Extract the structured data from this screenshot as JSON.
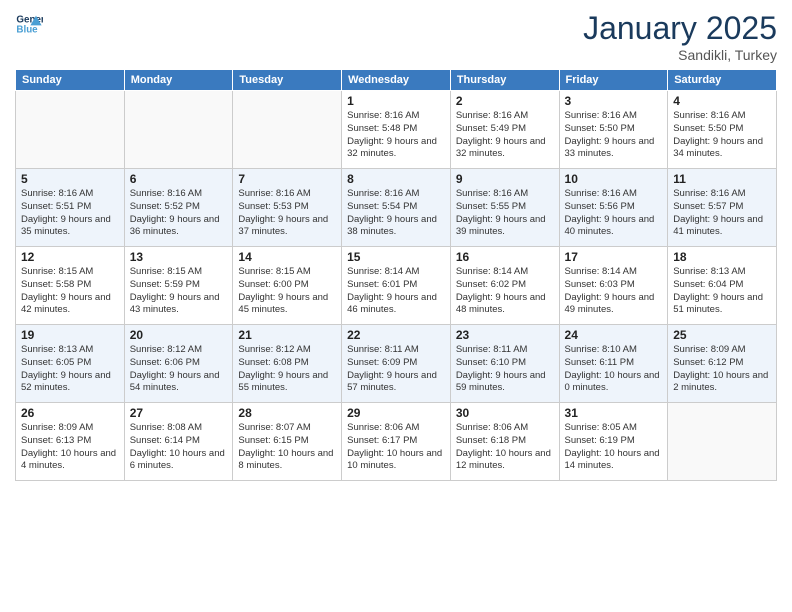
{
  "logo": {
    "line1": "General",
    "line2": "Blue"
  },
  "title": "January 2025",
  "subtitle": "Sandikli, Turkey",
  "weekdays": [
    "Sunday",
    "Monday",
    "Tuesday",
    "Wednesday",
    "Thursday",
    "Friday",
    "Saturday"
  ],
  "weeks": [
    [
      {
        "day": "",
        "info": ""
      },
      {
        "day": "",
        "info": ""
      },
      {
        "day": "",
        "info": ""
      },
      {
        "day": "1",
        "info": "Sunrise: 8:16 AM\nSunset: 5:48 PM\nDaylight: 9 hours and 32 minutes."
      },
      {
        "day": "2",
        "info": "Sunrise: 8:16 AM\nSunset: 5:49 PM\nDaylight: 9 hours and 32 minutes."
      },
      {
        "day": "3",
        "info": "Sunrise: 8:16 AM\nSunset: 5:50 PM\nDaylight: 9 hours and 33 minutes."
      },
      {
        "day": "4",
        "info": "Sunrise: 8:16 AM\nSunset: 5:50 PM\nDaylight: 9 hours and 34 minutes."
      }
    ],
    [
      {
        "day": "5",
        "info": "Sunrise: 8:16 AM\nSunset: 5:51 PM\nDaylight: 9 hours and 35 minutes."
      },
      {
        "day": "6",
        "info": "Sunrise: 8:16 AM\nSunset: 5:52 PM\nDaylight: 9 hours and 36 minutes."
      },
      {
        "day": "7",
        "info": "Sunrise: 8:16 AM\nSunset: 5:53 PM\nDaylight: 9 hours and 37 minutes."
      },
      {
        "day": "8",
        "info": "Sunrise: 8:16 AM\nSunset: 5:54 PM\nDaylight: 9 hours and 38 minutes."
      },
      {
        "day": "9",
        "info": "Sunrise: 8:16 AM\nSunset: 5:55 PM\nDaylight: 9 hours and 39 minutes."
      },
      {
        "day": "10",
        "info": "Sunrise: 8:16 AM\nSunset: 5:56 PM\nDaylight: 9 hours and 40 minutes."
      },
      {
        "day": "11",
        "info": "Sunrise: 8:16 AM\nSunset: 5:57 PM\nDaylight: 9 hours and 41 minutes."
      }
    ],
    [
      {
        "day": "12",
        "info": "Sunrise: 8:15 AM\nSunset: 5:58 PM\nDaylight: 9 hours and 42 minutes."
      },
      {
        "day": "13",
        "info": "Sunrise: 8:15 AM\nSunset: 5:59 PM\nDaylight: 9 hours and 43 minutes."
      },
      {
        "day": "14",
        "info": "Sunrise: 8:15 AM\nSunset: 6:00 PM\nDaylight: 9 hours and 45 minutes."
      },
      {
        "day": "15",
        "info": "Sunrise: 8:14 AM\nSunset: 6:01 PM\nDaylight: 9 hours and 46 minutes."
      },
      {
        "day": "16",
        "info": "Sunrise: 8:14 AM\nSunset: 6:02 PM\nDaylight: 9 hours and 48 minutes."
      },
      {
        "day": "17",
        "info": "Sunrise: 8:14 AM\nSunset: 6:03 PM\nDaylight: 9 hours and 49 minutes."
      },
      {
        "day": "18",
        "info": "Sunrise: 8:13 AM\nSunset: 6:04 PM\nDaylight: 9 hours and 51 minutes."
      }
    ],
    [
      {
        "day": "19",
        "info": "Sunrise: 8:13 AM\nSunset: 6:05 PM\nDaylight: 9 hours and 52 minutes."
      },
      {
        "day": "20",
        "info": "Sunrise: 8:12 AM\nSunset: 6:06 PM\nDaylight: 9 hours and 54 minutes."
      },
      {
        "day": "21",
        "info": "Sunrise: 8:12 AM\nSunset: 6:08 PM\nDaylight: 9 hours and 55 minutes."
      },
      {
        "day": "22",
        "info": "Sunrise: 8:11 AM\nSunset: 6:09 PM\nDaylight: 9 hours and 57 minutes."
      },
      {
        "day": "23",
        "info": "Sunrise: 8:11 AM\nSunset: 6:10 PM\nDaylight: 9 hours and 59 minutes."
      },
      {
        "day": "24",
        "info": "Sunrise: 8:10 AM\nSunset: 6:11 PM\nDaylight: 10 hours and 0 minutes."
      },
      {
        "day": "25",
        "info": "Sunrise: 8:09 AM\nSunset: 6:12 PM\nDaylight: 10 hours and 2 minutes."
      }
    ],
    [
      {
        "day": "26",
        "info": "Sunrise: 8:09 AM\nSunset: 6:13 PM\nDaylight: 10 hours and 4 minutes."
      },
      {
        "day": "27",
        "info": "Sunrise: 8:08 AM\nSunset: 6:14 PM\nDaylight: 10 hours and 6 minutes."
      },
      {
        "day": "28",
        "info": "Sunrise: 8:07 AM\nSunset: 6:15 PM\nDaylight: 10 hours and 8 minutes."
      },
      {
        "day": "29",
        "info": "Sunrise: 8:06 AM\nSunset: 6:17 PM\nDaylight: 10 hours and 10 minutes."
      },
      {
        "day": "30",
        "info": "Sunrise: 8:06 AM\nSunset: 6:18 PM\nDaylight: 10 hours and 12 minutes."
      },
      {
        "day": "31",
        "info": "Sunrise: 8:05 AM\nSunset: 6:19 PM\nDaylight: 10 hours and 14 minutes."
      },
      {
        "day": "",
        "info": ""
      }
    ]
  ]
}
